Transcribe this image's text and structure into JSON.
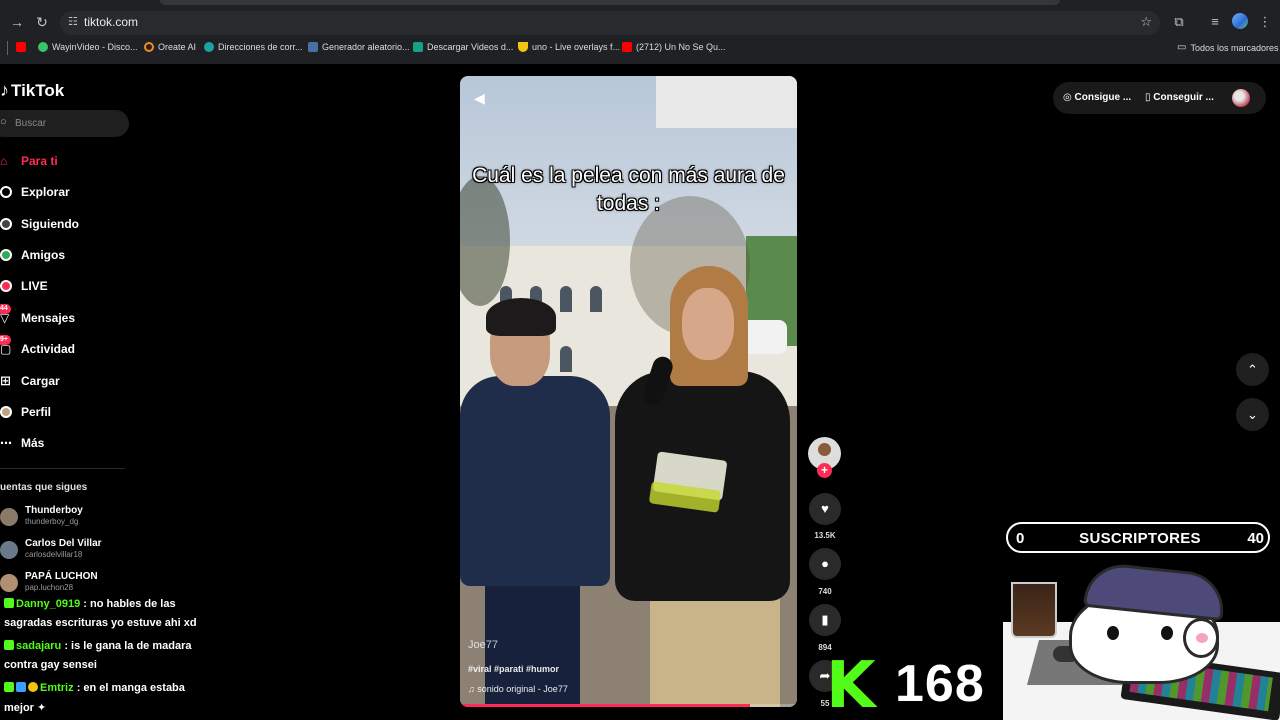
{
  "browser": {
    "url": "tiktok.com",
    "bookmarks": [
      "WayinVideo - Disco...",
      "Oreate AI",
      "Direcciones de corr...",
      "Generador aleatorio...",
      "Descargar Videos d...",
      "uno - Live overlays f...",
      "(2712) Un No Se Qu..."
    ],
    "all_bookmarks": "Todos los marcadores"
  },
  "tiktok": {
    "logo": "TikTok",
    "search_placeholder": "Buscar",
    "nav": [
      {
        "label": "Para ti",
        "icon": "home-icon",
        "active": true
      },
      {
        "label": "Explorar",
        "icon": "compass-icon"
      },
      {
        "label": "Siguiendo",
        "icon": "following-icon"
      },
      {
        "label": "Amigos",
        "icon": "friends-icon"
      },
      {
        "label": "LIVE",
        "icon": "live-icon"
      },
      {
        "label": "Mensajes",
        "icon": "messages-icon",
        "badge": "44"
      },
      {
        "label": "Actividad",
        "icon": "activity-icon",
        "badge": "9+"
      },
      {
        "label": "Cargar",
        "icon": "upload-icon"
      },
      {
        "label": "Perfil",
        "icon": "profile-icon"
      },
      {
        "label": "Más",
        "icon": "more-icon"
      }
    ],
    "following_title": "uentas que sigues",
    "accounts": [
      {
        "name": "Thunderboy",
        "username": "thunderboy_dg"
      },
      {
        "name": "Carlos Del Villar",
        "username": "carlosdelvillar18"
      },
      {
        "name": "PAPÁ LUCHON",
        "username": "pap.luchon28"
      }
    ],
    "video": {
      "caption": "Cuál es la pelea con más aura de todas :",
      "author": "Joe77",
      "tags": "#viral #parati #humor",
      "sound": "sonido original - Joe77",
      "progress": 0.86
    },
    "actions": {
      "likes": "13.5K",
      "comments": "740",
      "saves": "894",
      "shares": "55"
    },
    "promo": {
      "item1": "Consigue ...",
      "item2": "Conseguir ..."
    }
  },
  "stream": {
    "chat": [
      {
        "user": "Danny_0919",
        "text": ": no hables de las"
      },
      {
        "user": "",
        "text": "sagradas escrituras yo estuve ahi xd"
      },
      {
        "user": "sadajaru",
        "text": ": is le gana la de madara"
      },
      {
        "user": "",
        "text": "contra gay sensei"
      },
      {
        "user": "Emtriz",
        "text": ": en el manga estaba"
      },
      {
        "user": "",
        "text": "mejor"
      }
    ],
    "subs": {
      "current": "0",
      "label": "SUSCRIPTORES",
      "goal": "40"
    },
    "kick_logo": "K",
    "viewer_count": "168"
  },
  "colors": {
    "accent": "#fe2c55",
    "kick_green": "#53fc18",
    "background": "#000000"
  }
}
